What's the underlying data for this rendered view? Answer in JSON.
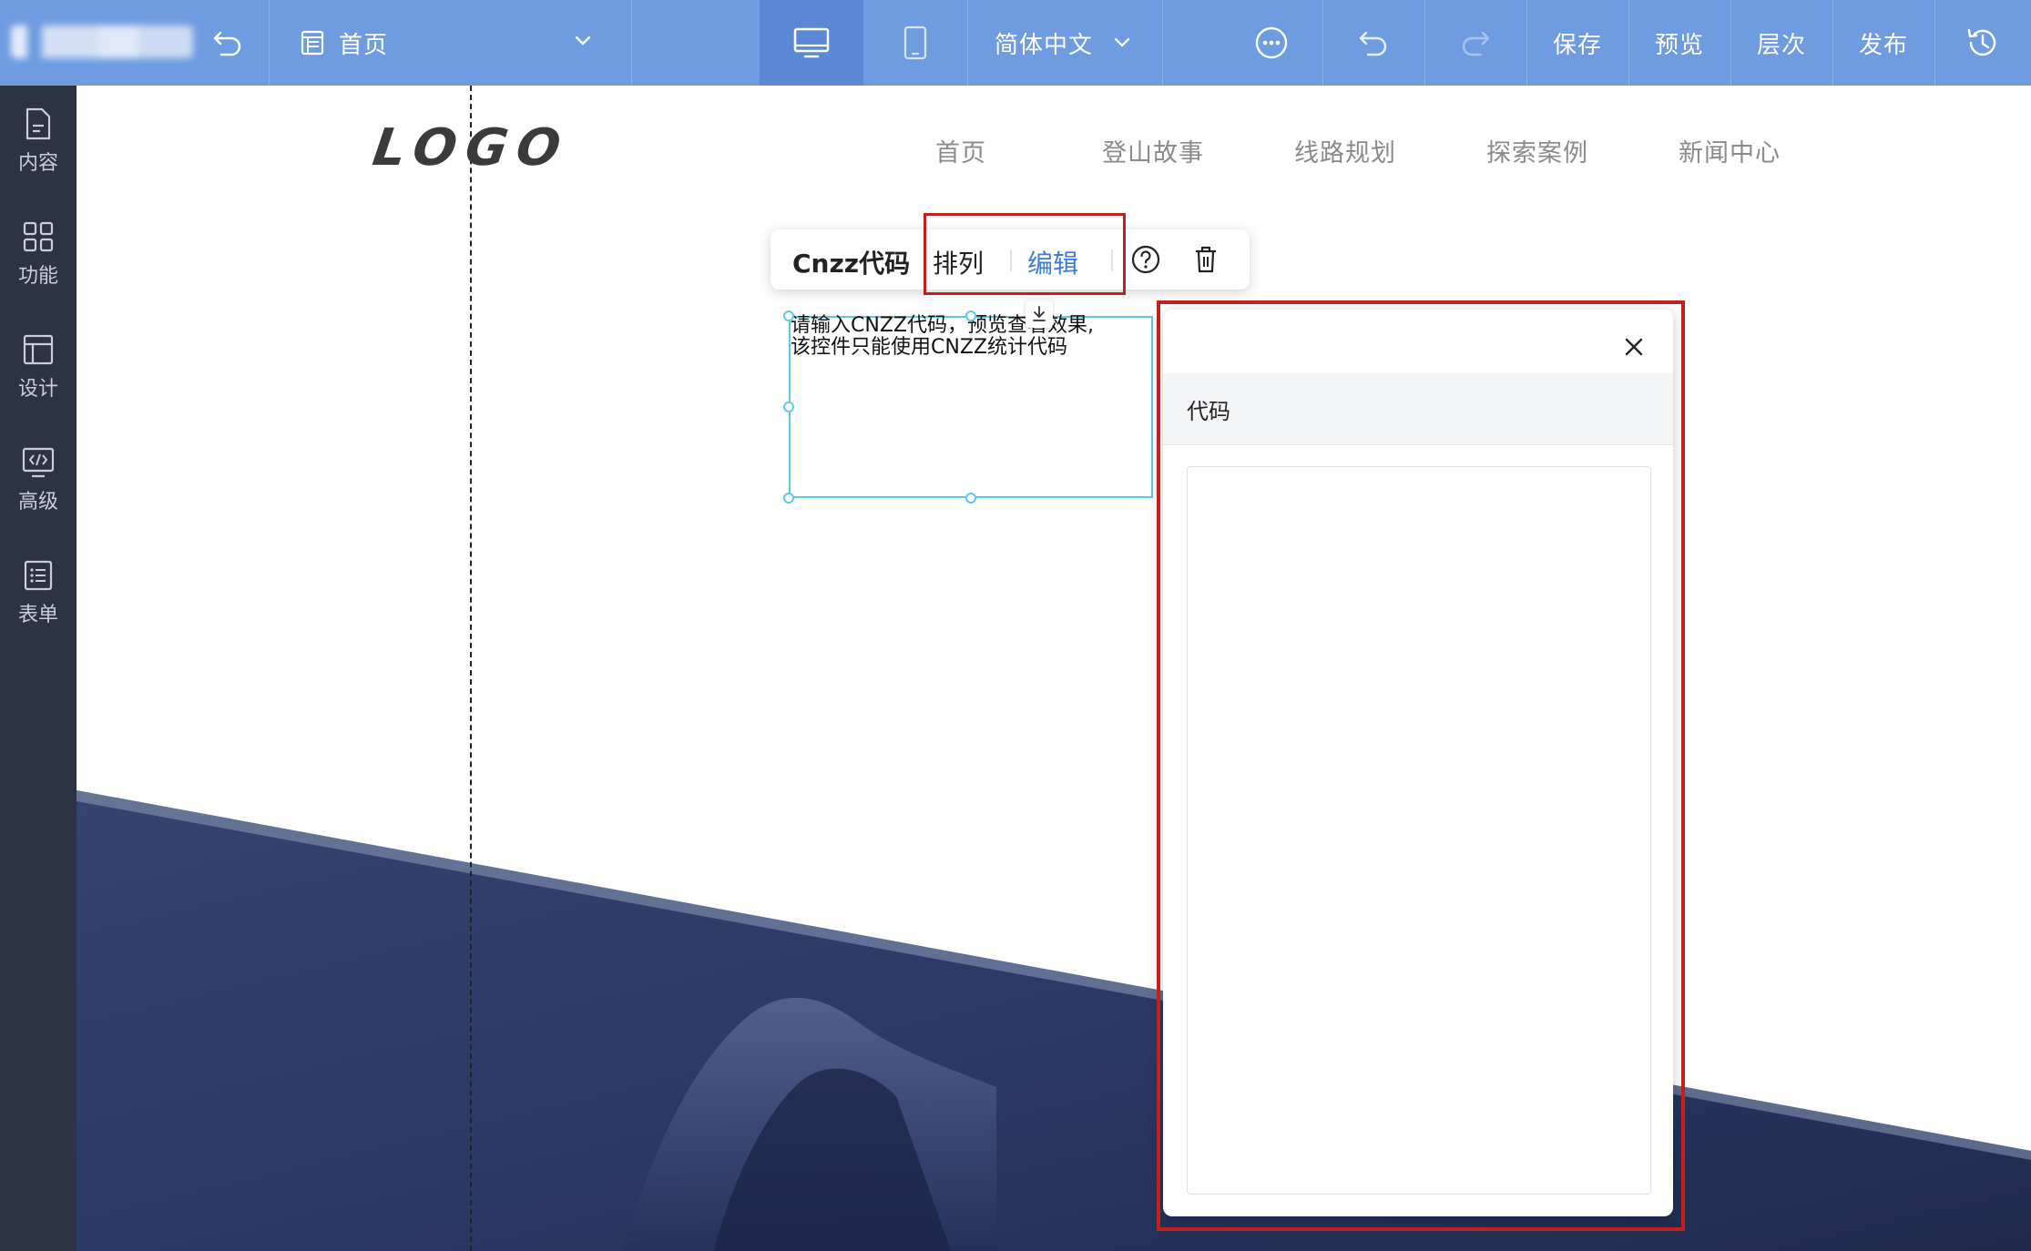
{
  "topbar": {
    "page_name": "首页",
    "language": "简体中文",
    "save": "保存",
    "preview": "预览",
    "layers": "层次",
    "publish": "发布"
  },
  "sidebar": {
    "items": [
      {
        "label": "内容",
        "icon": "document-icon"
      },
      {
        "label": "功能",
        "icon": "grid-icon"
      },
      {
        "label": "设计",
        "icon": "layout-icon"
      },
      {
        "label": "高级",
        "icon": "code-monitor-icon"
      },
      {
        "label": "表单",
        "icon": "list-icon"
      }
    ]
  },
  "site": {
    "logo": "LOGO",
    "nav": [
      "首页",
      "登山故事",
      "线路规划",
      "探索案例",
      "新闻中心"
    ]
  },
  "toolbar": {
    "title": "Cnzz代码",
    "arrange": "排列",
    "edit": "编辑"
  },
  "widget": {
    "text_line1": "请输入CNZZ代码，预览查看效果,",
    "text_line2": "该控件只能使用CNZZ统计代码"
  },
  "panel": {
    "tab_label": "代码",
    "code_value": ""
  },
  "colors": {
    "topbar": "#6f9be1",
    "sidebar": "#2c3342",
    "accent_blue": "#3d7bd8",
    "highlight_red": "#c0201e",
    "selection": "#5ec8e6",
    "hero_dark": "#26335a"
  }
}
